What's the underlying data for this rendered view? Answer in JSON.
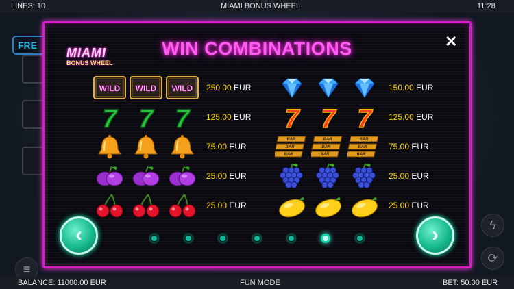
{
  "topbar": {
    "lines": "LINES: 10",
    "game_title": "MIAMI BONUS WHEEL",
    "time": "11:28"
  },
  "bottombar": {
    "balance": "BALANCE: 11000.00 EUR",
    "mode": "FUN MODE",
    "bet": "BET: 50.00 EUR"
  },
  "background": {
    "free_label": "FRE"
  },
  "panel": {
    "title": "WIN COMBINATIONS",
    "close_icon": "close-icon",
    "logo": {
      "line1": "MIAMI",
      "line2": "BONUS WHEEL"
    },
    "left_column": [
      {
        "symbol": "wild",
        "symbol_text": "WILD",
        "value": "250.00",
        "currency": "EUR"
      },
      {
        "symbol": "green-seven",
        "symbol_text": "7",
        "value": "125.00",
        "currency": "EUR"
      },
      {
        "symbol": "bell",
        "value": "75.00",
        "currency": "EUR"
      },
      {
        "symbol": "plum",
        "value": "25.00",
        "currency": "EUR"
      },
      {
        "symbol": "cherry",
        "value": "25.00",
        "currency": "EUR"
      }
    ],
    "right_column": [
      {
        "symbol": "diamond",
        "value": "150.00",
        "currency": "EUR"
      },
      {
        "symbol": "red-seven",
        "symbol_text": "7",
        "value": "125.00",
        "currency": "EUR"
      },
      {
        "symbol": "bar",
        "symbol_text": "BAR",
        "value": "75.00",
        "currency": "EUR"
      },
      {
        "symbol": "grapes",
        "value": "25.00",
        "currency": "EUR"
      },
      {
        "symbol": "lemon",
        "value": "25.00",
        "currency": "EUR"
      }
    ],
    "pagination": {
      "total_pages": 7,
      "active_page": 6
    },
    "prev_icon": "chevron-left-icon",
    "next_icon": "chevron-right-icon"
  },
  "colors": {
    "neon_pink": "#ff2ee6",
    "amount_yellow": "#ffd400",
    "teal": "#16b98e"
  }
}
